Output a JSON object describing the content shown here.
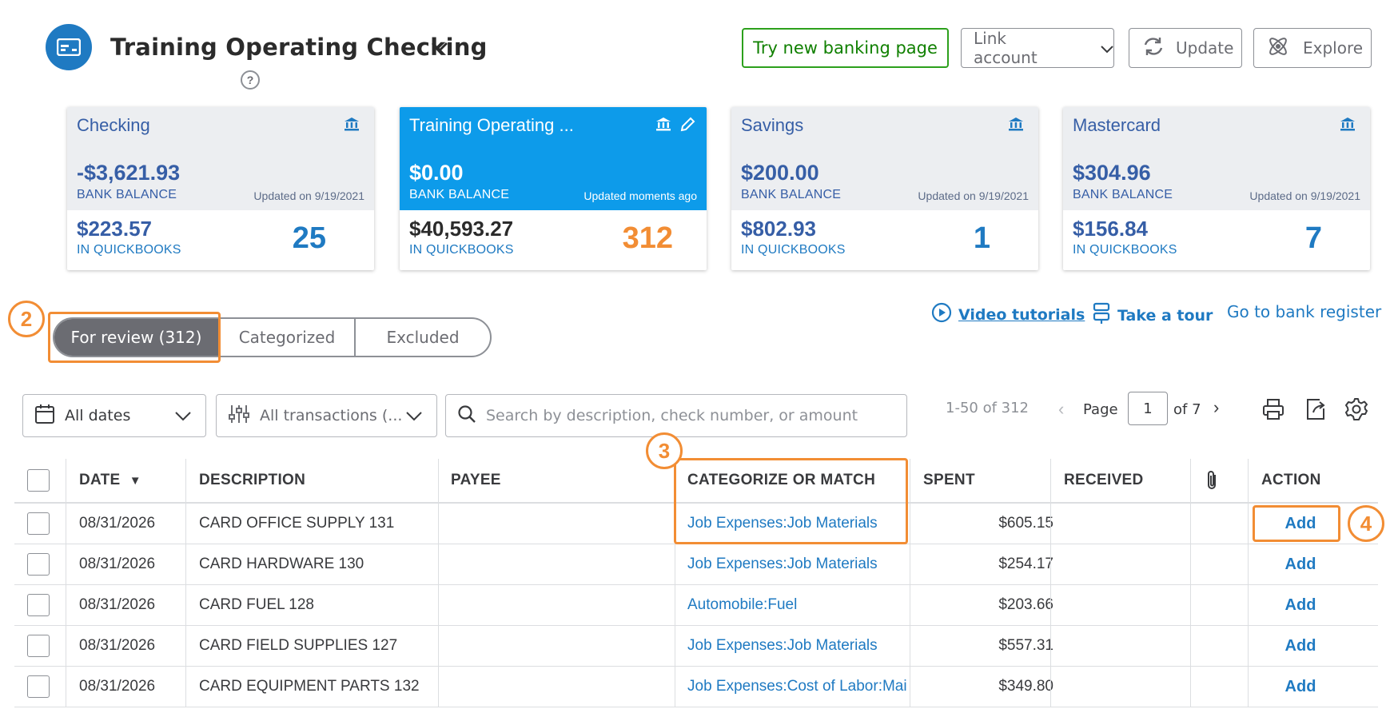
{
  "header": {
    "account_title": "Training Operating Checking",
    "help_symbol": "?",
    "try_new_label": "Try new banking page",
    "link_account_label": "Link account",
    "update_label": "Update",
    "explore_label": "Explore"
  },
  "accounts": [
    {
      "name": "Checking",
      "bank_balance": "-$3,621.93",
      "bank_balance_label": "BANK BALANCE",
      "updated": "Updated on 9/19/2021",
      "qb_balance": "$223.57",
      "qb_label": "IN QUICKBOOKS",
      "count": "25"
    },
    {
      "name": "Training Operating ...",
      "bank_balance": "$0.00",
      "bank_balance_label": "BANK BALANCE",
      "updated": "Updated moments ago",
      "qb_balance": "$40,593.27",
      "qb_label": "IN QUICKBOOKS",
      "count": "312"
    },
    {
      "name": "Savings",
      "bank_balance": "$200.00",
      "bank_balance_label": "BANK BALANCE",
      "updated": "Updated on 9/19/2021",
      "qb_balance": "$802.93",
      "qb_label": "IN QUICKBOOKS",
      "count": "1"
    },
    {
      "name": "Mastercard",
      "bank_balance": "$304.96",
      "bank_balance_label": "BANK BALANCE",
      "updated": "Updated on 9/19/2021",
      "qb_balance": "$156.84",
      "qb_label": "IN QUICKBOOKS",
      "count": "7"
    }
  ],
  "tabs": {
    "for_review": "For review (312)",
    "categorized": "Categorized",
    "excluded": "Excluded"
  },
  "links": {
    "video": "Video tutorials",
    "tour": "Take a tour",
    "register": "Go to bank register"
  },
  "filters": {
    "dates": "All dates",
    "transactions": "All transactions (...",
    "search_placeholder": "Search by description, check number, or amount"
  },
  "pager": {
    "range": "1-50 of 312",
    "page_label": "Page",
    "page_value": "1",
    "of_label": "of 7"
  },
  "table": {
    "headers": {
      "date": "DATE",
      "sort_indicator": "▼",
      "description": "DESCRIPTION",
      "payee": "PAYEE",
      "category": "CATEGORIZE OR MATCH",
      "spent": "SPENT",
      "received": "RECEIVED",
      "action": "ACTION"
    },
    "rows": [
      {
        "date": "08/31/2026",
        "description": "CARD OFFICE SUPPLY 131",
        "payee": "",
        "category": "Job Expenses:Job Materials",
        "spent": "$605.15",
        "received": "",
        "action": "Add"
      },
      {
        "date": "08/31/2026",
        "description": "CARD HARDWARE 130",
        "payee": "",
        "category": "Job Expenses:Job Materials",
        "spent": "$254.17",
        "received": "",
        "action": "Add"
      },
      {
        "date": "08/31/2026",
        "description": "CARD FUEL 128",
        "payee": "",
        "category": "Automobile:Fuel",
        "spent": "$203.66",
        "received": "",
        "action": "Add"
      },
      {
        "date": "08/31/2026",
        "description": "CARD FIELD SUPPLIES 127",
        "payee": "",
        "category": "Job Expenses:Job Materials",
        "spent": "$557.31",
        "received": "",
        "action": "Add"
      },
      {
        "date": "08/31/2026",
        "description": "CARD EQUIPMENT PARTS 132",
        "payee": "",
        "category": "Job Expenses:Cost of Labor:Mai",
        "spent": "$349.80",
        "received": "",
        "action": "Add"
      }
    ]
  },
  "annotations": {
    "step2": "2",
    "step3": "3",
    "step4": "4"
  },
  "colors": {
    "brand_blue": "#1f7ac2",
    "active_card": "#0d9bea",
    "green": "#2ca01c",
    "annotation_orange": "#f28d34"
  },
  "icons": [
    "bank-card-icon",
    "chevron-down-icon",
    "help-icon",
    "refresh-icon",
    "atom-icon",
    "bank-icon",
    "pencil-icon",
    "play-circle-icon",
    "tour-icon",
    "calendar-icon",
    "sliders-icon",
    "search-icon",
    "print-icon",
    "export-icon",
    "gear-icon",
    "paperclip-icon"
  ]
}
